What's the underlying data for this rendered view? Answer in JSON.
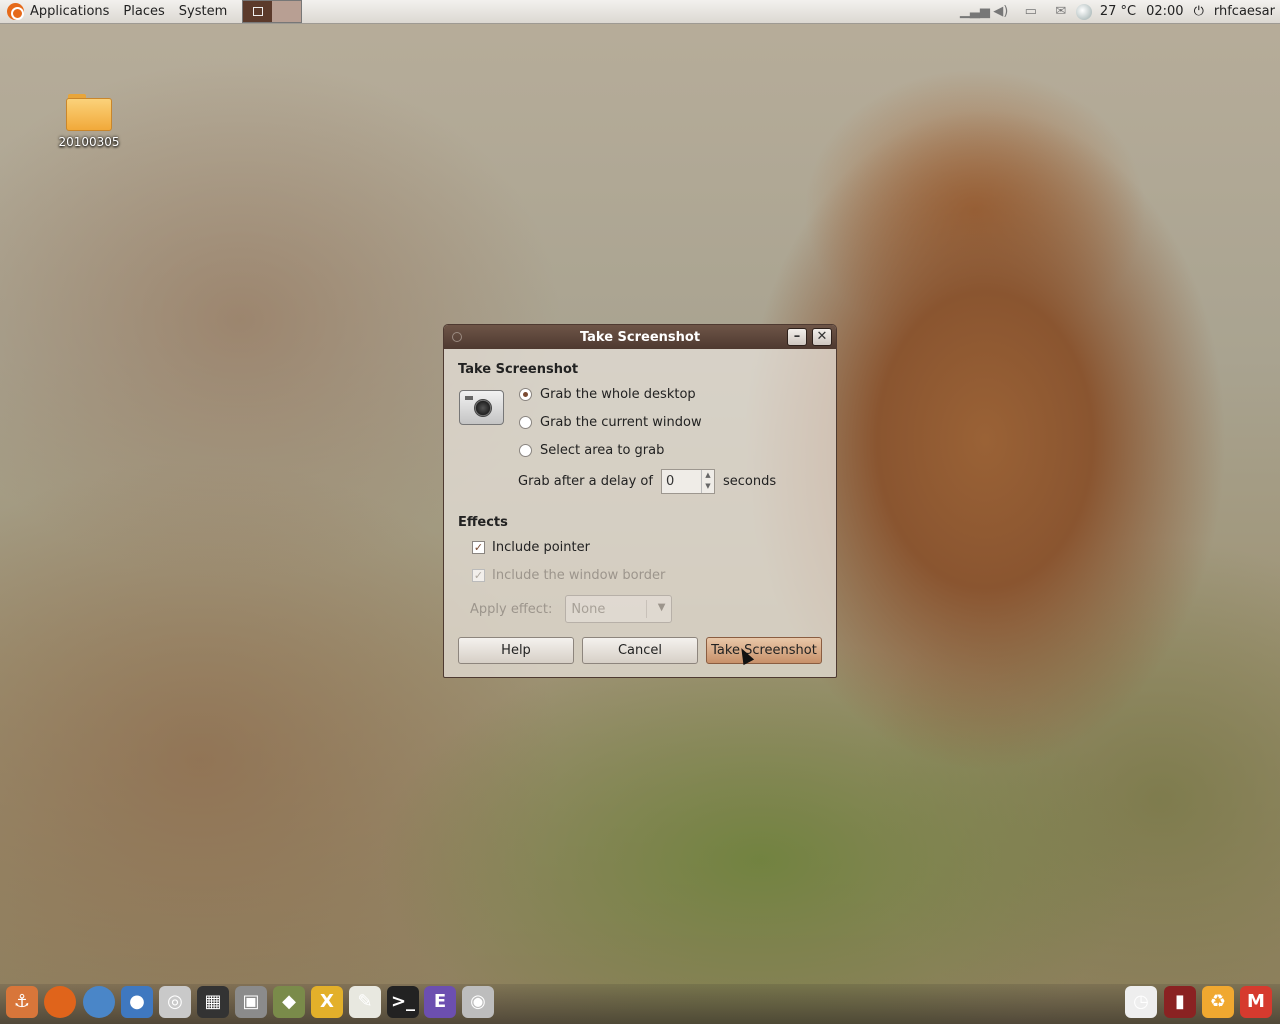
{
  "top_panel": {
    "menus": [
      "Applications",
      "Places",
      "System"
    ],
    "weather": "27 °C",
    "clock": "02:00",
    "user": "rhfcaesar",
    "tray_icons": [
      "network-signal-icon",
      "volume-icon",
      "printer-icon",
      "mail-icon",
      "weather-icon",
      "power-icon"
    ]
  },
  "desktop": {
    "folder_label": "20100305"
  },
  "dialog": {
    "window_title": "Take Screenshot",
    "heading": "Take Screenshot",
    "options": [
      {
        "label": "Grab the whole desktop",
        "checked": true
      },
      {
        "label": "Grab the current window",
        "checked": false
      },
      {
        "label": "Select area to grab",
        "checked": false
      }
    ],
    "delay_label": "Grab after a delay of",
    "delay_value": "0",
    "delay_unit": "seconds",
    "effects_heading": "Effects",
    "include_pointer": {
      "label": "Include pointer",
      "checked": true
    },
    "include_border": {
      "label": "Include the window border",
      "checked": true,
      "disabled": true
    },
    "apply_effect_label": "Apply effect:",
    "apply_effect_value": "None",
    "buttons": {
      "help": "Help",
      "cancel": "Cancel",
      "take": "Take Screenshot"
    },
    "titlebar_buttons": {
      "minimize": "–",
      "close": "✕"
    }
  },
  "dock": {
    "items": [
      {
        "name": "anchor-icon",
        "glyph": "⚓",
        "color": "#d8763a"
      },
      {
        "name": "firefox-icon",
        "glyph": "",
        "color": "#e0641b"
      },
      {
        "name": "chromium-icon",
        "glyph": "",
        "color": "#4a86c8"
      },
      {
        "name": "messenger-icon",
        "glyph": "●",
        "color": "#3f78c0"
      },
      {
        "name": "ipod-icon",
        "glyph": "◎",
        "color": "#c9c9c9"
      },
      {
        "name": "movie-clapper-icon",
        "glyph": "▦",
        "color": "#333333"
      },
      {
        "name": "photo-viewer-icon",
        "glyph": "▣",
        "color": "#8b8b8b"
      },
      {
        "name": "package-icon",
        "glyph": "◆",
        "color": "#7a8b4a"
      },
      {
        "name": "lyx-icon",
        "glyph": "X",
        "color": "#e3b02a"
      },
      {
        "name": "text-editor-icon",
        "glyph": "✎",
        "color": "#e8e8e0"
      },
      {
        "name": "terminal-icon",
        "glyph": ">_",
        "color": "#222222"
      },
      {
        "name": "emacs-icon",
        "glyph": "E",
        "color": "#6c4fb0"
      },
      {
        "name": "screenshot-camera-icon",
        "glyph": "◉",
        "color": "#bdbdbd"
      },
      {
        "name": "clock-icon",
        "glyph": "◷",
        "color": "#eeeeee"
      },
      {
        "name": "workspace-icon",
        "glyph": "▮",
        "color": "#8a2222"
      },
      {
        "name": "recycle-icon",
        "glyph": "♻",
        "color": "#f0a830"
      },
      {
        "name": "gmail-icon",
        "glyph": "M",
        "color": "#d63a2e"
      }
    ]
  }
}
